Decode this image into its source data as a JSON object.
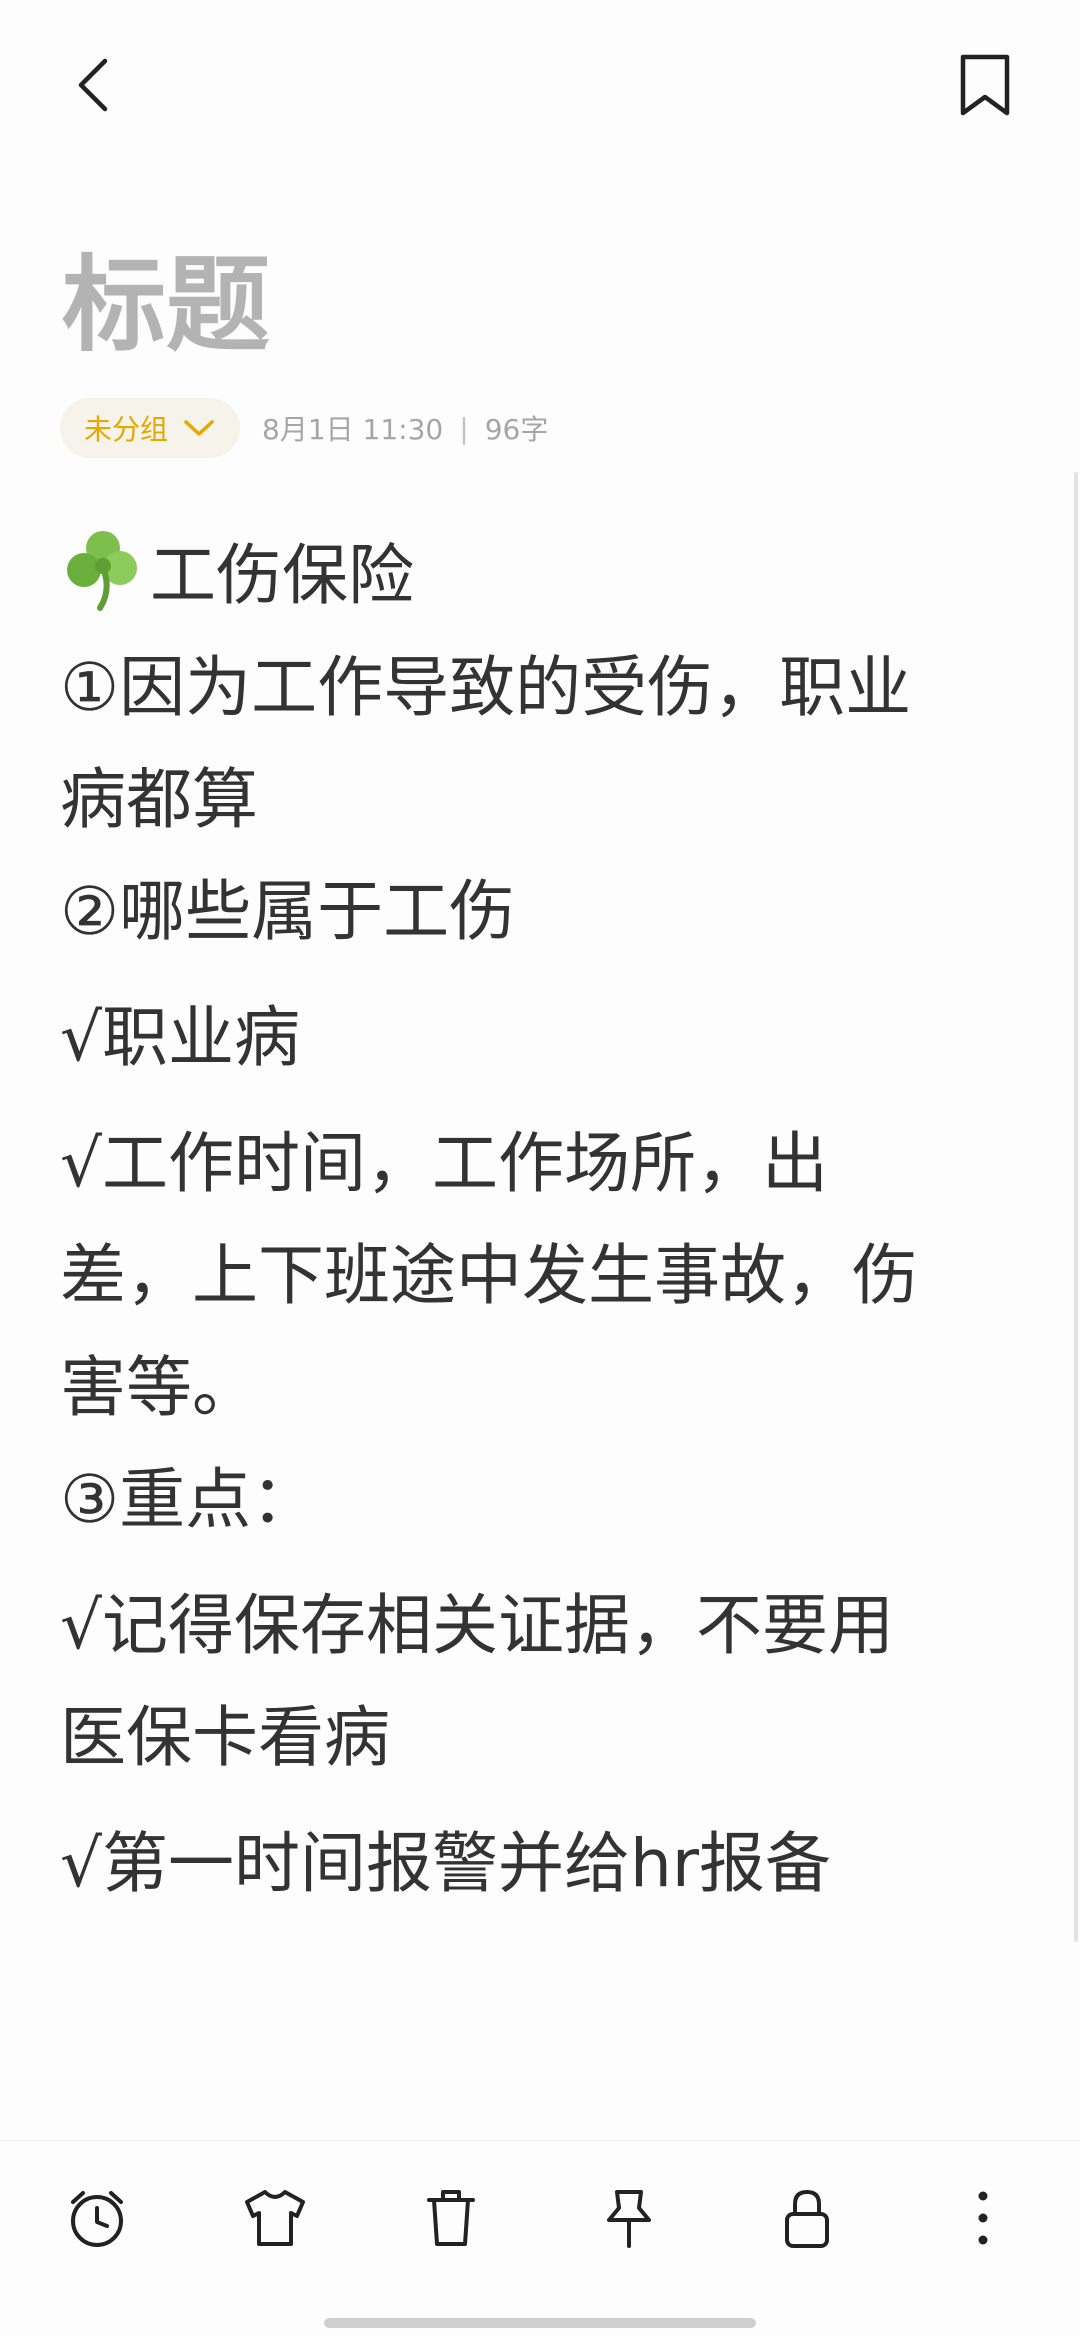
{
  "note": {
    "title": "标题",
    "group": "未分组",
    "datetime": "8月1日 11:30",
    "separator": "|",
    "word_count": "96字"
  },
  "content": {
    "line1": "工伤保险",
    "line2": "①因为工作导致的受伤，职业",
    "line3": "病都算",
    "line4": "②哪些属于工伤",
    "line5": "√职业病",
    "line6": "√工作时间，工作场所，出",
    "line7": "差，上下班途中发生事故，伤",
    "line8": "害等。",
    "line9": "③重点：",
    "line10": "√记得保存相关证据，不要用",
    "line11": "医保卡看病",
    "line12": "√第一时间报警并给hr报备"
  },
  "icons": {
    "back": "back-arrow-icon",
    "bookmark": "bookmark-icon",
    "clover": "shamrock-icon",
    "alarm": "alarm-clock-icon",
    "theme": "tshirt-icon",
    "delete": "trash-icon",
    "pin": "pin-icon",
    "lock": "lock-icon",
    "more": "more-vertical-icon"
  },
  "colors": {
    "accent": "#e6a700",
    "text": "#333333",
    "title": "#b3b3b3",
    "clover": "#7cbf4b"
  }
}
